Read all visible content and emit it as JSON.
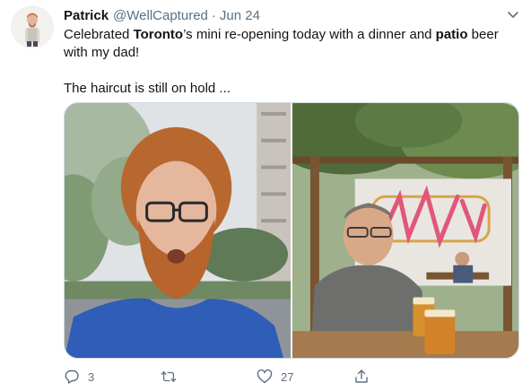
{
  "tweet": {
    "author": {
      "display_name": "Patrick",
      "handle": "@WellCaptured"
    },
    "separator": "·",
    "date": "Jun 24",
    "text": {
      "line1_prefix": "Celebrated ",
      "line1_bold1": "Toronto",
      "line1_mid": "’s mini re-opening today with a dinner and ",
      "line1_bold2": "patio",
      "line1_suffix": " beer with my dad!",
      "line2": "The haircut is still on hold ..."
    },
    "media": {
      "photo_count": 2
    },
    "actions": {
      "reply_count": "3",
      "retweet_count": "",
      "like_count": "27",
      "share_count": ""
    },
    "icons": {
      "menu": "chevron-down-icon",
      "reply": "reply-icon",
      "retweet": "retweet-icon",
      "like": "heart-icon",
      "share": "share-icon"
    },
    "colors": {
      "text_primary": "#0f1419",
      "text_secondary": "#5b7083",
      "border": "#cfd9de"
    }
  }
}
